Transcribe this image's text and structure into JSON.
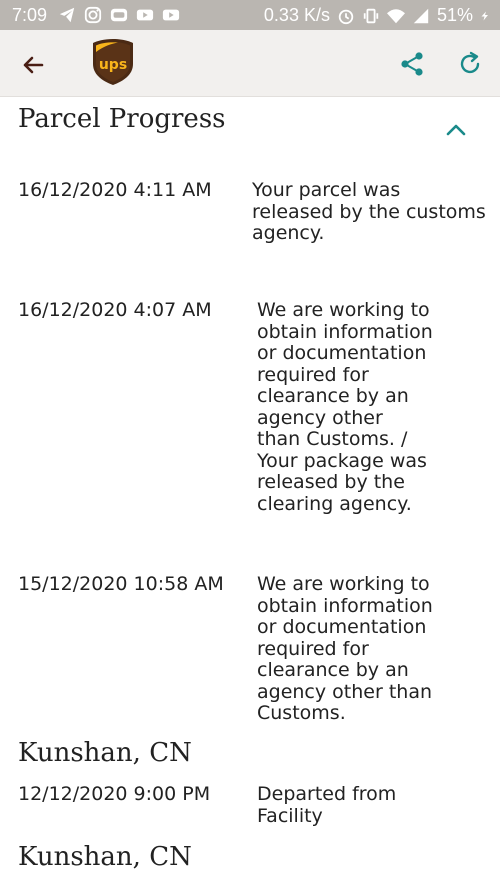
{
  "status_bar": {
    "time": "7:09",
    "speed": "0.33 K/s",
    "battery": "51%",
    "icons": [
      "telegram-icon",
      "instagram-icon",
      "badge-icon",
      "youtube-icon",
      "youtube-icon",
      "alarm-icon",
      "vibrate-icon",
      "wifi-icon",
      "signal-icon",
      "battery-charging-icon"
    ]
  },
  "app_bar": {
    "back_icon": "arrow-left-icon",
    "logo": "ups",
    "share_icon": "share-icon",
    "refresh_icon": "refresh-icon",
    "accent": "#1a8a8a"
  },
  "section": {
    "title": "Parcel Progress",
    "collapse_icon": "chevron-up-icon"
  },
  "events": [
    {
      "date": "16/12/2020 4:11 AM",
      "desc": [
        "Your parcel was",
        "released by the customs",
        "agency."
      ]
    },
    {
      "date": "16/12/2020  4:07 AM",
      "desc": [
        "We are working to",
        "obtain information",
        "or documentation",
        "required for",
        "clearance by an",
        "agency other",
        "than Customs. /",
        "Your package was",
        "released by the",
        "clearing agency."
      ]
    },
    {
      "date": "15/12/2020  10:58 AM",
      "desc": [
        "We are working to",
        "obtain information",
        "or documentation",
        "required for",
        "clearance by an",
        "agency other than",
        "Customs."
      ]
    }
  ],
  "locations": [
    {
      "name": "Kunshan, CN",
      "events": [
        {
          "date": "12/12/2020  9:00 PM",
          "desc": [
            "Departed from",
            "Facility"
          ]
        }
      ]
    },
    {
      "name": "Kunshan, CN",
      "events": []
    }
  ]
}
